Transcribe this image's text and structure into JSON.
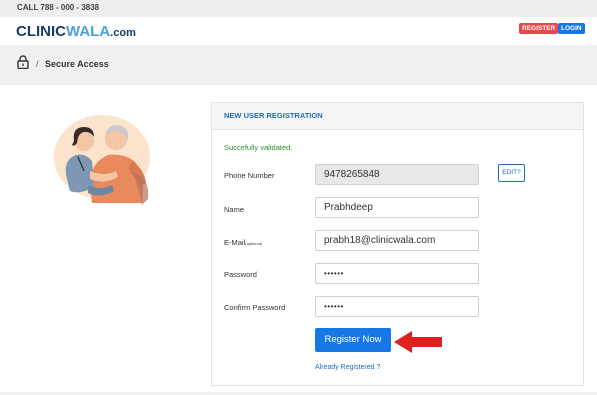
{
  "topbar": {
    "phone": "CALL 788 - 000 - 3838"
  },
  "brand": {
    "logo_part1": "CLINIC",
    "logo_part2": "WALA",
    "logo_part3": ".com"
  },
  "header_buttons": {
    "register": "REGISTER",
    "login": "LOGIN"
  },
  "breadcrumb": {
    "separator": "/",
    "current": "Secure Access"
  },
  "card": {
    "title": "NEW USER REGISTRATION"
  },
  "status": {
    "message": "Succefully validated."
  },
  "form": {
    "phone": {
      "label": "Phone Number",
      "value": "9478265848"
    },
    "edit_button": "EDIT?",
    "name": {
      "label": "Name",
      "value": "Prabhdeep"
    },
    "email": {
      "label": "E-Mail",
      "label_note": "(optional)",
      "value": "prabh18@clinicwala.com"
    },
    "password": {
      "label": "Password",
      "value": "••••••"
    },
    "confirm_password": {
      "label": "Confirm Password",
      "value": "••••••"
    },
    "submit_button": "Register Now",
    "already_registered_link": "Already Registered ?"
  },
  "colors": {
    "primary_blue": "#1578e6",
    "register_red": "#e8474b",
    "success_green": "#2e8b2e",
    "arrow_red": "#e02020"
  }
}
